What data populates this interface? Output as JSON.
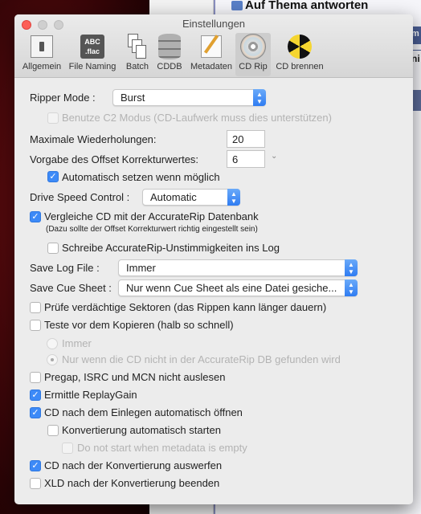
{
  "background": {
    "window_title": "Auf Thema antworten",
    "partial_right_1": "m",
    "partial_right_2": "ni"
  },
  "window": {
    "title": "Einstellungen"
  },
  "toolbar": [
    {
      "label": "Allgemein",
      "icon": "switch-icon"
    },
    {
      "label": "File Naming",
      "icon": "abc-flac-icon"
    },
    {
      "label": "Batch",
      "icon": "documents-icon"
    },
    {
      "label": "CDDB",
      "icon": "database-icon"
    },
    {
      "label": "Metadaten",
      "icon": "pencil-paper-icon"
    },
    {
      "label": "CD Rip",
      "icon": "cd-icon",
      "selected": true
    },
    {
      "label": "CD brennen",
      "icon": "radiation-icon"
    }
  ],
  "settings": {
    "ripper_mode": {
      "label": "Ripper Mode :",
      "value": "Burst"
    },
    "c2": {
      "label": "Benutze C2 Modus (CD-Laufwerk muss dies unterstützen)",
      "checked": false,
      "enabled": false
    },
    "max_retries": {
      "label": "Maximale Wiederholungen:",
      "value": "20"
    },
    "offset": {
      "label": "Vorgabe des Offset Korrekturwertes:",
      "value": "6"
    },
    "auto_offset": {
      "label": "Automatisch setzen wenn möglich",
      "checked": true
    },
    "drive_speed": {
      "label": "Drive Speed Control :",
      "value": "Automatic"
    },
    "accuraterip": {
      "label": "Vergleiche CD mit der AccurateRip Datenbank",
      "note": "(Dazu sollte der Offset Korrekturwert richtig eingestellt sein)",
      "checked": true
    },
    "accuraterip_log": {
      "label": "Schreibe AccurateRip-Unstimmigkeiten ins Log",
      "checked": false
    },
    "save_log": {
      "label": "Save Log File :",
      "value": "Immer"
    },
    "save_cue": {
      "label": "Save Cue Sheet :",
      "value": "Nur wenn Cue Sheet als eine Datei gesiche..."
    },
    "suspicious": {
      "label": "Prüfe verdächtige Sektoren (das Rippen kann länger dauern)",
      "checked": false
    },
    "test": {
      "label": "Teste vor dem Kopieren (halb so schnell)",
      "checked": false
    },
    "test_always": {
      "label": "Immer",
      "selected": false
    },
    "test_notfound": {
      "label": "Nur wenn die CD nicht in der AccurateRip DB gefunden wird",
      "selected": true
    },
    "pregap": {
      "label": "Pregap, ISRC und MCN nicht auslesen",
      "checked": false
    },
    "replaygain": {
      "label": "Ermittle ReplayGain",
      "checked": true
    },
    "auto_open": {
      "label": "CD nach dem Einlegen automatisch öffnen",
      "checked": true
    },
    "auto_convert": {
      "label": "Konvertierung automatisch starten",
      "checked": false
    },
    "no_meta": {
      "label": "Do not start when metadata is empty",
      "checked": false
    },
    "eject": {
      "label": "CD nach der Konvertierung auswerfen",
      "checked": true
    },
    "quit": {
      "label": "XLD nach der Konvertierung beenden",
      "checked": false
    }
  }
}
